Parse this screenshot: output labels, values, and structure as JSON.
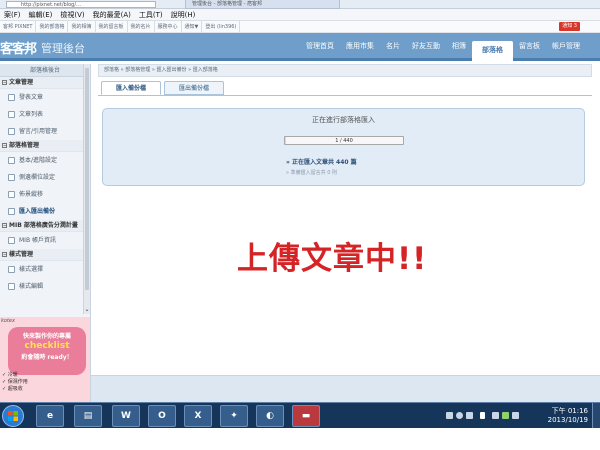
{
  "browser": {
    "address": "http://pixnet.net/blog/…",
    "tab_title": "管理後台 - 部落格管理 - 痞客邦",
    "menu": [
      "案(F)",
      "編輯(E)",
      "檢視(V)",
      "我的最愛(A)",
      "工具(T)",
      "說明(H)"
    ],
    "favorites": [
      "客邦 PIXNET",
      "我的部落格",
      "我的相簿",
      "我的留言板",
      "我的名片",
      "服務中心",
      "通知▼",
      "登出 (lin396)"
    ],
    "notice_badge": "通知 3"
  },
  "site": {
    "logo": "客客邦",
    "admin_title": "管理後台",
    "nav": [
      "管理首頁",
      "應用市集",
      "名片",
      "好友互動",
      "相簿",
      "部落格",
      "留言板",
      "帳戶管理"
    ],
    "nav_active": "部落格"
  },
  "sidebar": {
    "header": "部落格後台",
    "sections": [
      {
        "title": "文章管理",
        "items": [
          "發表文章",
          "文章列表",
          "留言/引用管理"
        ]
      },
      {
        "title": "部落格管理",
        "items": [
          "基本/進階設定",
          "側邊欄位設定",
          "佈景縱移",
          "匯入匯出備份"
        ]
      },
      {
        "title": "MIB 部落格廣告分潤計畫",
        "items": [
          "MIB 帳戶資訊"
        ]
      },
      {
        "title": "樣式管理",
        "items": [
          "樣式選擇",
          "樣式編輯"
        ]
      }
    ],
    "current_item": "匯入匯出備份",
    "scroll_arrow": "⌄"
  },
  "promo": {
    "brand": "kotex",
    "line1": "快來製作你的專屬",
    "highlight": "checklist",
    "line2": "約會隨時 ready！",
    "checks": [
      "✓ 冷暖",
      "✓ 保濕作用",
      "✓ 超吸收"
    ]
  },
  "breadcrumb": "部落格 » 部落格管理 » 匯入匯出備份 » 匯入部落格",
  "tabs": [
    "匯入備份檔",
    "匯出備份檔"
  ],
  "active_tab": "匯入備份檔",
  "import": {
    "status": "正在進行部落格匯入",
    "progress_text": "1 / 440",
    "progress_fraction": 0.0023,
    "line1": "» 正在匯入文章共 440 篇",
    "line2": "» 準備匯入留言共 0 則"
  },
  "overlay_message": "上傳文章中!!",
  "taskbar": {
    "apps": [
      "e",
      "▤",
      "W",
      "O",
      "X",
      "✦",
      "◐",
      "▬"
    ],
    "time": "下午 01:16",
    "date": "2013/10/19"
  },
  "colors": {
    "header_blue": "#6e9ec9",
    "panel_bg": "#e2ecf7",
    "overlay_red": "#d42426",
    "taskbar": "#16355a"
  }
}
